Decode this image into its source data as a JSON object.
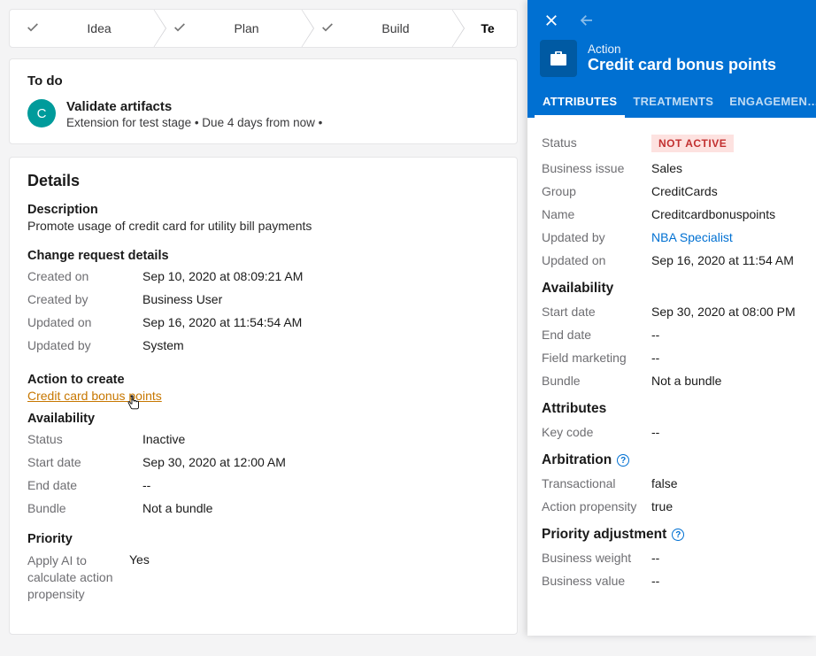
{
  "stages": {
    "s0": {
      "label": "Idea"
    },
    "s1": {
      "label": "Plan"
    },
    "s2": {
      "label": "Build"
    },
    "s3": {
      "label": "Te"
    }
  },
  "todo": {
    "header": "To do",
    "avatar_initial": "C",
    "title": "Validate artifacts",
    "subtitle": "Extension for test stage  •  Due 4 days from now  •"
  },
  "details": {
    "title": "Details",
    "description_h": "Description",
    "description": "Promote usage of credit card for utility bill payments",
    "cr_h": "Change request details",
    "cr": {
      "created_on_k": "Created on",
      "created_on": "Sep 10, 2020 at 08:09:21 AM",
      "created_by_k": "Created by",
      "created_by": "Business User",
      "updated_on_k": "Updated on",
      "updated_on": "Sep 16, 2020 at 11:54:54 AM",
      "updated_by_k": "Updated by",
      "updated_by": "System"
    },
    "action_h": "Action to create",
    "action_link": "Credit card bonus points",
    "avail_h": "Availability",
    "avail": {
      "status_k": "Status",
      "status": "Inactive",
      "start_k": "Start date",
      "start": "Sep 30, 2020 at 12:00 AM",
      "end_k": "End date",
      "end": "--",
      "bundle_k": "Bundle",
      "bundle": "Not a bundle"
    },
    "priority_h": "Priority",
    "priority": {
      "ai_k": "Apply AI to calculate action propensity",
      "ai": "Yes"
    }
  },
  "panel": {
    "kind": "Action",
    "title": "Credit card bonus points",
    "tabs": {
      "t0": "ATTRIBUTES",
      "t1": "TREATMENTS",
      "t2": "ENGAGEMEN…"
    },
    "attrs": {
      "status_k": "Status",
      "status_badge": "NOT ACTIVE",
      "bi_k": "Business issue",
      "bi": "Sales",
      "group_k": "Group",
      "group": "CreditCards",
      "name_k": "Name",
      "name": "Creditcardbonuspoints",
      "uby_k": "Updated by",
      "uby": "NBA Specialist",
      "uon_k": "Updated on",
      "uon": "Sep 16, 2020 at 11:54 AM"
    },
    "avail_h": "Availability",
    "avail": {
      "start_k": "Start date",
      "start": "Sep 30, 2020 at 08:00 PM",
      "end_k": "End date",
      "end": "--",
      "fm_k": "Field marketing",
      "fm": "--",
      "bundle_k": "Bundle",
      "bundle": "Not a bundle"
    },
    "attr2_h": "Attributes",
    "attr2": {
      "key_k": "Key code",
      "key": "--"
    },
    "arb_h": "Arbitration",
    "arb": {
      "txn_k": "Transactional",
      "txn": "false",
      "ap_k": "Action propensity",
      "ap": "true"
    },
    "pa_h": "Priority adjustment",
    "pa": {
      "bw_k": "Business weight",
      "bw": "--",
      "bv_k": "Business value",
      "bv": "--"
    }
  }
}
